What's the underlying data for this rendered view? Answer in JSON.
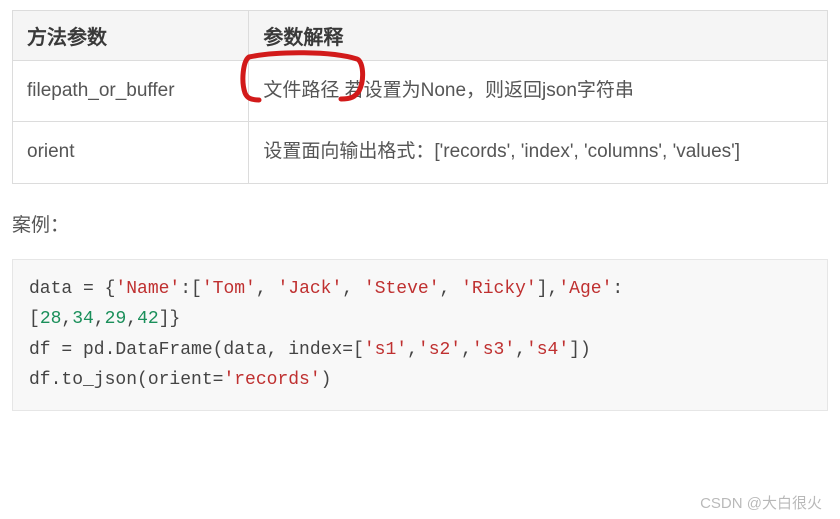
{
  "table": {
    "headers": [
      "方法参数",
      "参数解释"
    ],
    "rows": [
      {
        "param": "filepath_or_buffer",
        "desc_highlight": "文件路径",
        "desc_rest": "  若设置为None，则返回json字符串"
      },
      {
        "param": "orient",
        "desc": "设置面向输出格式：['records', 'index', 'columns', 'values']"
      }
    ]
  },
  "example_label": "案例：",
  "code": {
    "t0": "data = {",
    "s_name": "'Name'",
    "t1": ":[",
    "s_tom": "'Tom'",
    "t_c": ", ",
    "s_jack": "'Jack'",
    "s_steve": "'Steve'",
    "s_ricky": "'Ricky'",
    "t2": "],",
    "s_age": "'Age'",
    "t3": ":",
    "t_nl": "\n",
    "t4": "[",
    "n28": "28",
    "tcn": ",",
    "n34": "34",
    "n29": "29",
    "n42": "42",
    "t5": "]}",
    "l3a": "df = pd.DataFrame(data, index=[",
    "s_s1": "'s1'",
    "s_s2": "'s2'",
    "s_s3": "'s3'",
    "s_s4": "'s4'",
    "l3b": "])",
    "l4a": "df.to_json(orient=",
    "s_rec": "'records'",
    "l4b": ")"
  },
  "watermark": "CSDN @大白很火"
}
